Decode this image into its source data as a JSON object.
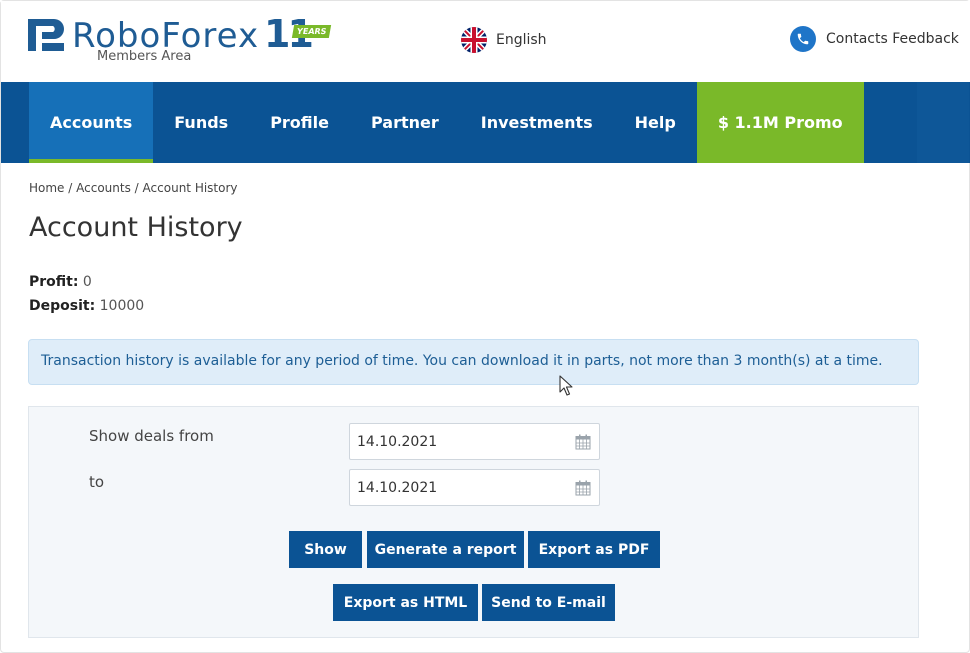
{
  "header": {
    "brand": "RoboForex",
    "brand_sub": "Members Area",
    "years_number": "11",
    "years_label": "YEARS",
    "language": "English",
    "contacts_label": "Contacts Feedback"
  },
  "nav": {
    "items": [
      {
        "label": "Accounts"
      },
      {
        "label": "Funds"
      },
      {
        "label": "Profile"
      },
      {
        "label": "Partner"
      },
      {
        "label": "Investments"
      },
      {
        "label": "Help"
      }
    ],
    "promo_label": "$ 1.1M Promo"
  },
  "breadcrumb": {
    "home": "Home",
    "accounts": "Accounts",
    "current": "Account History",
    "separator": "/"
  },
  "page": {
    "title": "Account History",
    "profit_label": "Profit:",
    "profit_value": "0",
    "deposit_label": "Deposit:",
    "deposit_value": "10000"
  },
  "notice": {
    "text": "Transaction history is available for any period of time. You can download it in parts, not more than 3 month(s) at a time."
  },
  "filter": {
    "from_label": "Show deals from",
    "from_value": "14.10.2021",
    "to_label": "to",
    "to_value": "14.10.2021"
  },
  "buttons": {
    "show": "Show",
    "generate_report": "Generate a report",
    "export_pdf": "Export as PDF",
    "export_html": "Export as HTML",
    "send_email": "Send to E-mail"
  },
  "colors": {
    "brand_blue": "#0b5394",
    "active_blue": "#1670b8",
    "accent_green": "#7ab929",
    "notice_bg": "#dfedf9"
  },
  "icons": {
    "logo": "roboforex-logo-icon",
    "flag": "uk-flag-icon",
    "contacts": "phone-icon",
    "calendar": "calendar-icon",
    "cursor": "mouse-pointer-icon"
  }
}
